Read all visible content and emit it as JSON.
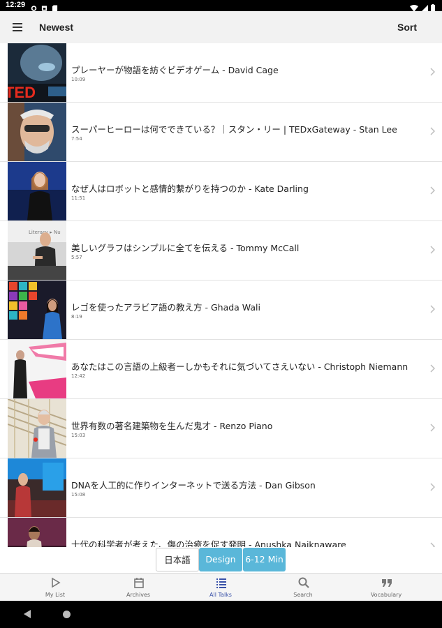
{
  "status_bar": {
    "time": "12:29"
  },
  "app_bar": {
    "title": "Newest",
    "sort_label": "Sort"
  },
  "talks": [
    {
      "title": "プレーヤーが物語を紡ぐビデオゲーム - David Cage",
      "duration": "10:09"
    },
    {
      "title": "スーパーヒーローは何でできている？｜スタン・リー | TEDxGateway - Stan Lee",
      "duration": "7:54"
    },
    {
      "title": "なぜ人はロボットと感情的繋がりを持つのか - Kate Darling",
      "duration": "11:51"
    },
    {
      "title": "美しいグラフはシンプルに全てを伝える - Tommy McCall",
      "duration": "5:57"
    },
    {
      "title": "レゴを使ったアラビア語の教え方 - Ghada Wali",
      "duration": "8:19"
    },
    {
      "title": "あなたはこの言語の上級者ーしかもそれに気づいてさえいない - Christoph Niemann",
      "duration": "12:42"
    },
    {
      "title": "世界有数の著名建築物を生んだ鬼才 - Renzo Piano",
      "duration": "15:03"
    },
    {
      "title": "DNAを人工的に作りインターネットで送る方法 - Dan Gibson",
      "duration": "15:08"
    },
    {
      "title": "十代の科学者が考えた、傷の治癒を促す発明 - Anushka Naiknaware",
      "duration": ""
    }
  ],
  "filters": {
    "language": "日本語",
    "chips": [
      "Design",
      "6-12 Min"
    ]
  },
  "bottom_nav": [
    {
      "label": "My List",
      "icon": "play-icon"
    },
    {
      "label": "Archives",
      "icon": "calendar-icon"
    },
    {
      "label": "All Talks",
      "icon": "list-icon"
    },
    {
      "label": "Search",
      "icon": "search-icon"
    },
    {
      "label": "Vocabulary",
      "icon": "quote-icon"
    }
  ],
  "colors": {
    "accent": "#3951a8",
    "chip": "#5ab7d9",
    "appbar": "#f2f2f2"
  }
}
